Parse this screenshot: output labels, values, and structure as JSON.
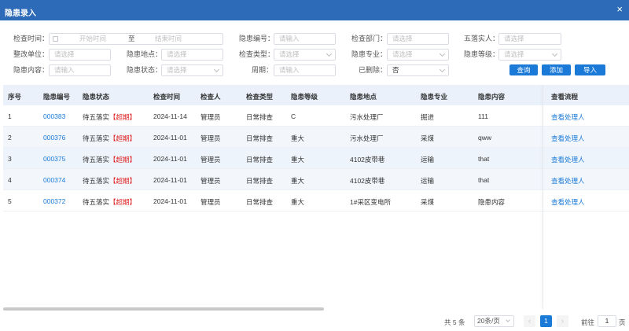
{
  "window": {
    "title": "隐患录入",
    "close_glyph": "×"
  },
  "filters": {
    "check_time_label": "检查时间：",
    "start_placeholder": "开始时间",
    "range_sep": "至",
    "end_placeholder": "结束时间",
    "hazard_no_label": "隐患编号：",
    "hazard_no_placeholder": "请输入",
    "dept_label": "检查部门：",
    "dept_placeholder": "请选择",
    "five_person_label": "五落实人：",
    "five_person_placeholder": "请选择",
    "rect_unit_label": "整改单位：",
    "rect_unit_placeholder": "请选择",
    "location_label": "隐患地点：",
    "location_placeholder": "请选择",
    "check_type_label": "检查类型：",
    "check_type_placeholder": "请选择",
    "specialty_label": "隐患专业：",
    "specialty_placeholder": "请选择",
    "level_label": "隐患等级：",
    "level_placeholder": "请选择",
    "content_label": "隐患内容：",
    "content_placeholder": "请输入",
    "status_label": "隐患状态：",
    "status_placeholder": "请选择",
    "period_label": "周期：",
    "period_placeholder": "请输入",
    "deleted_label": "已删除：",
    "deleted_value": "否"
  },
  "buttons": {
    "query": "查询",
    "add": "添加",
    "import": "导入"
  },
  "table": {
    "headers": [
      "序号",
      "隐患编号",
      "隐患状态",
      "检查时间",
      "检查人",
      "检查类型",
      "隐患等级",
      "隐患地点",
      "隐患专业",
      "隐患内容",
      "查看流程"
    ],
    "rows": [
      {
        "seq": "1",
        "no": "000383",
        "status": "待五落实",
        "overdue": "【超期】",
        "time": "2024-11-14",
        "inspector": "管理员",
        "type": "日常排查",
        "level": "C",
        "location": "污水处理厂",
        "specialty": "掘进",
        "content": "111",
        "action": "查看处理人"
      },
      {
        "seq": "2",
        "no": "000376",
        "status": "待五落实",
        "overdue": "【超期】",
        "time": "2024-11-01",
        "inspector": "管理员",
        "type": "日常排查",
        "level": "重大",
        "location": "污水处理厂",
        "specialty": "采煤",
        "content": "qww",
        "action": "查看处理人"
      },
      {
        "seq": "3",
        "no": "000375",
        "status": "待五落实",
        "overdue": "【超期】",
        "time": "2024-11-01",
        "inspector": "管理员",
        "type": "日常排查",
        "level": "重大",
        "location": "4102皮带巷",
        "specialty": "运输",
        "content": "that",
        "action": "查看处理人"
      },
      {
        "seq": "4",
        "no": "000374",
        "status": "待五落实",
        "overdue": "【超期】",
        "time": "2024-11-01",
        "inspector": "管理员",
        "type": "日常排查",
        "level": "重大",
        "location": "4102皮带巷",
        "specialty": "运输",
        "content": "that",
        "action": "查看处理人"
      },
      {
        "seq": "5",
        "no": "000372",
        "status": "待五落实",
        "overdue": "【超期】",
        "time": "2024-11-01",
        "inspector": "管理员",
        "type": "日常排查",
        "level": "重大",
        "location": "1#采区变电所",
        "specialty": "采煤",
        "content": "隐患内容",
        "action": "查看处理人"
      }
    ]
  },
  "pagination": {
    "total": "共 5 条",
    "page_size": "20条/页",
    "prev": "‹",
    "current": "1",
    "next": "›",
    "goto_label": "前往",
    "goto_value": "1",
    "goto_suffix": "页"
  },
  "icons": {
    "calendar": "calendar-icon",
    "chevron": "chevron-down-icon"
  },
  "colors": {
    "header": "#2d6bb8",
    "accent": "#1b7ad8",
    "overdue": "#e02020"
  }
}
